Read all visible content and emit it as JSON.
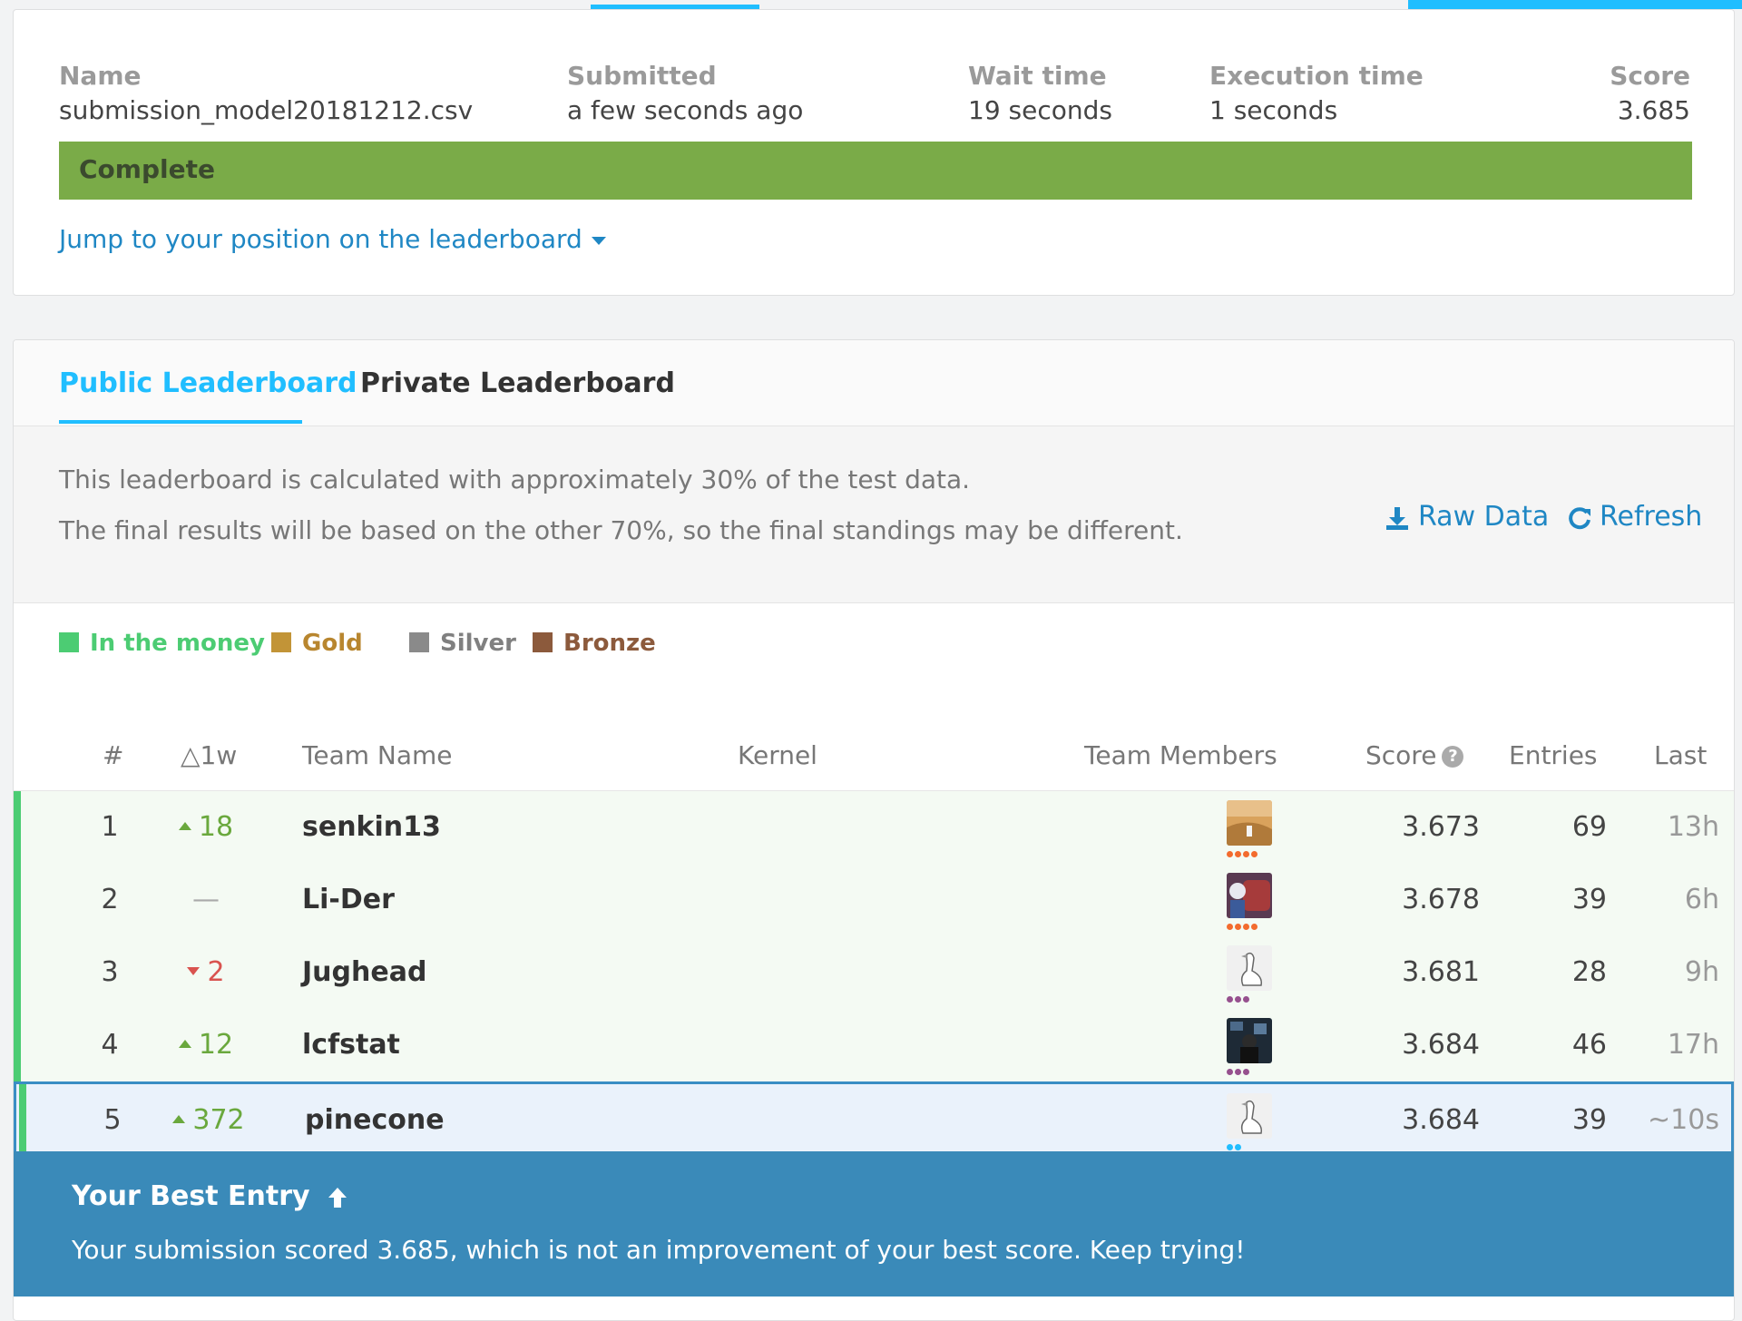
{
  "submission": {
    "columns": [
      {
        "label": "Name",
        "value": "submission_model20181212.csv"
      },
      {
        "label": "Submitted",
        "value": "a few seconds ago"
      },
      {
        "label": "Wait time",
        "value": "19 seconds"
      },
      {
        "label": "Execution time",
        "value": "1 seconds"
      },
      {
        "label": "Score",
        "value": "3.685"
      }
    ],
    "status": "Complete",
    "jump_link": "Jump to your position on the leaderboard"
  },
  "leaderboard": {
    "tabs": [
      {
        "label": "Public Leaderboard"
      },
      {
        "label": "Private Leaderboard"
      }
    ],
    "notice": {
      "line1": "This leaderboard is calculated with approximately 30% of the test data.",
      "line2": "The final results will be based on the other 70%, so the final standings may be different."
    },
    "actions": {
      "raw_data": "Raw Data",
      "refresh": "Refresh"
    },
    "legend": [
      {
        "label": "In the money",
        "color": "#4ccc73"
      },
      {
        "label": "Gold",
        "color": "#c29437"
      },
      {
        "label": "Silver",
        "color": "#8a8a8a"
      },
      {
        "label": "Bronze",
        "color": "#8c5a3c"
      }
    ],
    "headers": {
      "rank": "#",
      "delta": "△1w",
      "team": "Team Name",
      "kernel": "Kernel",
      "members": "Team Members",
      "score": "Score",
      "entries": "Entries",
      "last": "Last"
    },
    "rows": [
      {
        "rank": "1",
        "delta": "18",
        "delta_dir": "up",
        "team": "senkin13",
        "score": "3.673",
        "entries": "69",
        "last": "13h"
      },
      {
        "rank": "2",
        "delta": "—",
        "delta_dir": "same",
        "team": "Li-Der",
        "score": "3.678",
        "entries": "39",
        "last": "6h"
      },
      {
        "rank": "3",
        "delta": "2",
        "delta_dir": "down",
        "team": "Jughead",
        "score": "3.681",
        "entries": "28",
        "last": "9h"
      },
      {
        "rank": "4",
        "delta": "12",
        "delta_dir": "up",
        "team": "lcfstat",
        "score": "3.684",
        "entries": "46",
        "last": "17h"
      },
      {
        "rank": "5",
        "delta": "372",
        "delta_dir": "up",
        "team": "pinecone",
        "score": "3.684",
        "entries": "39",
        "last": "~10s"
      }
    ],
    "best_entry": {
      "title": "Your Best Entry",
      "message": "Your submission scored 3.685, which is not an improvement of your best score. Keep trying!"
    }
  },
  "colors": {
    "accent": "#20beff",
    "link": "#1f87c4",
    "complete": "#7aab48",
    "banner": "#3a8ab9"
  }
}
